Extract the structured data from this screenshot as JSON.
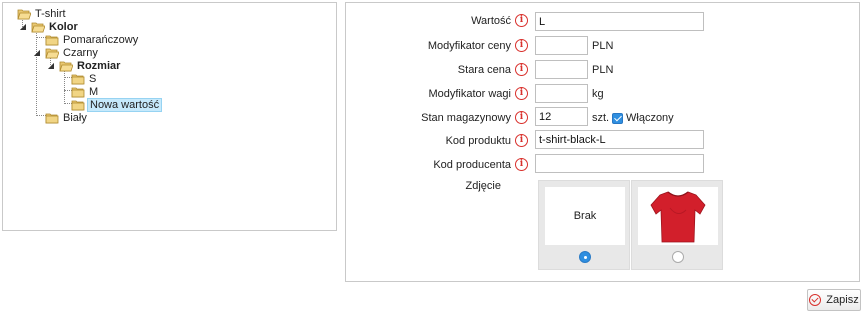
{
  "tree": {
    "root": "T-shirt",
    "kolor": "Kolor",
    "pomaranczowy": "Pomarańczowy",
    "czarny": "Czarny",
    "rozmiar": "Rozmiar",
    "s": "S",
    "m": "M",
    "nowa": "Nowa wartość",
    "bialy": "Biały"
  },
  "form": {
    "wartosc_label": "Wartość",
    "wartosc_value": "L",
    "mod_ceny_label": "Modyfikator ceny",
    "mod_ceny_value": "",
    "currency": "PLN",
    "stara_cena_label": "Stara cena",
    "stara_cena_value": "",
    "mod_wagi_label": "Modyfikator wagi",
    "mod_wagi_value": "",
    "weight_unit": "kg",
    "stan_label": "Stan magazynowy",
    "stan_value": "12",
    "stock_unit": "szt.",
    "wlaczony_label": "Włączony",
    "wlaczony_checked": true,
    "kod_produktu_label": "Kod produktu",
    "kod_produktu_value": "t-shirt-black-L",
    "kod_producenta_label": "Kod producenta",
    "kod_producenta_value": "",
    "zdjecie_label": "Zdjęcie",
    "photo_none_label": "Brak",
    "selected_photo": "none",
    "info_glyph": "i"
  },
  "save_label": "Zapisz",
  "colors": {
    "accent": "#2f8fe0",
    "info_red": "#d9302c",
    "selection": "#c6e9fb",
    "tshirt": "#d21f2b"
  }
}
